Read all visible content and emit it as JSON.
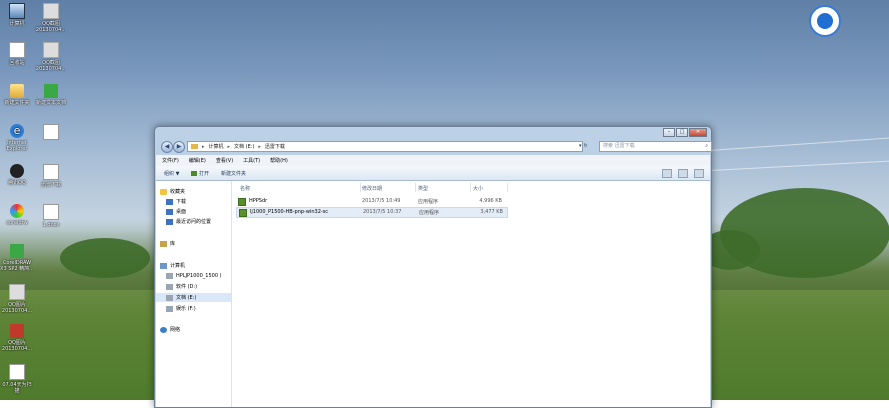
{
  "desktop": {
    "icons": [
      {
        "label": "计算机",
        "glyph": "computer-icon"
      },
      {
        "label": "QQ截图 20130704...",
        "glyph": "image-icon"
      },
      {
        "label": "回收站",
        "glyph": "recycle-bin-icon"
      },
      {
        "label": "QQ截图 20130704...",
        "glyph": "image-icon"
      },
      {
        "label": "新建文件夹",
        "glyph": "folder-icon"
      },
      {
        "label": "新建文本文档",
        "glyph": "document-icon"
      },
      {
        "label": "Internet Explorer",
        "glyph": "ie-icon"
      },
      {
        "label": "",
        "glyph": "document-icon"
      },
      {
        "label": "腾讯QQ",
        "glyph": "qq-icon"
      },
      {
        "label": "迅雷下载",
        "glyph": "document-icon"
      },
      {
        "label": "coreldrw",
        "glyph": "coreldraw-icon"
      },
      {
        "label": "1.docx",
        "glyph": "document-icon"
      },
      {
        "label": "CorelDRAW X3 SP2 精简...",
        "glyph": "coreldraw-icon"
      },
      {
        "label": "QQ图片 20130704...",
        "glyph": "image-icon"
      },
      {
        "label": "QQ图片 20130704...",
        "glyph": "image-icon"
      },
      {
        "label": "07.04天为扫描",
        "glyph": "document-icon"
      }
    ]
  },
  "explorer": {
    "breadcrumb": [
      "计算机",
      "文档 (E:)",
      "迅雷下载"
    ],
    "search_placeholder": "搜索 迅雷下载",
    "menu": [
      "文件(F)",
      "编辑(E)",
      "查看(V)",
      "工具(T)",
      "帮助(H)"
    ],
    "toolbar": {
      "organize": "组织 ▼",
      "open": "打开",
      "new_folder": "新建文件夹"
    },
    "nav": {
      "favorites": "收藏夹",
      "downloads": "下载",
      "desktop": "桌面",
      "recent": "最近访问的位置",
      "libraries": "库",
      "computer": "计算机",
      "drive_hp": "HPLJP1000_1500 (",
      "drive_d": "软件 (D:)",
      "drive_e": "文档 (E:)",
      "drive_f": "娱乐 (F:)",
      "network": "网络"
    },
    "columns": {
      "name": "名称",
      "date": "修改日期",
      "type": "类型",
      "size": "大小"
    },
    "files": [
      {
        "name": "HPPSdr",
        "date": "2013/7/5 10:49",
        "type": "应用程序",
        "size": "4,996 KB"
      },
      {
        "name": "lj1000_P1500-HB-pnp-win32-sc",
        "date": "2013/7/5 10:37",
        "type": "应用程序",
        "size": "3,477 KB"
      }
    ]
  }
}
